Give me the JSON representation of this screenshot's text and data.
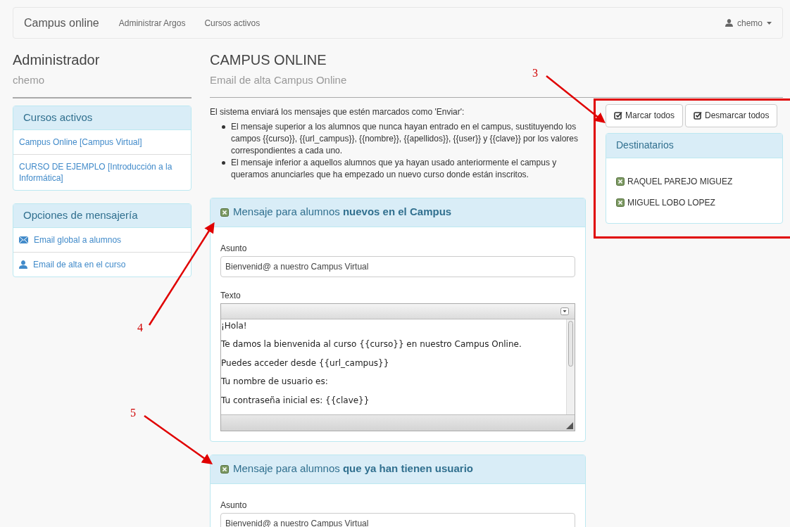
{
  "navbar": {
    "brand": "Campus online",
    "links": [
      "Administrar Argos",
      "Cursos activos"
    ],
    "user": "chemo"
  },
  "sidebar": {
    "title": "Administrador",
    "subtitle": "chemo",
    "panels": [
      {
        "title": "Cursos activos",
        "items": [
          {
            "label": "Campus Online [Campus Virtual]"
          },
          {
            "label": "CURSO DE EJEMPLO [Introducción a la Informática]"
          }
        ]
      },
      {
        "title": "Opciones de mensajería",
        "items": [
          {
            "label": "Email global a alumnos",
            "kind": "envelope"
          },
          {
            "label": "Email de alta en el curso",
            "kind": "user"
          }
        ]
      }
    ]
  },
  "page": {
    "title": "CAMPUS ONLINE",
    "subtitle": "Email de alta Campus Online"
  },
  "intro": {
    "text": "El sistema enviará los mensajes que estén marcados como 'Enviar':",
    "bullets": [
      "El mensaje superior a los alumnos que nunca hayan entrado en el campus, sustituyendo los campos {{curso}}, {{url_campus}}, {{nombre}}, {{apellidos}}, {{user}} y {{clave}} por los valores correspondientes a cada uno.",
      "El mensaje inferior a aquellos alumnos que ya hayan usado anteriormente el campus y queramos anunciarles que ha empezado un nuevo curso donde están inscritos."
    ]
  },
  "messages": [
    {
      "title": "Mensaje para alumnos **nuevos en el Campus**",
      "checked": true,
      "subject_label": "Asunto",
      "subject": "Bienvenid@ a nuestro Campus Virtual",
      "text_label": "Texto",
      "body": [
        "¡Hola!",
        "Te damos la bienvenida al curso {{curso}} en nuestro Campus Online.",
        "Puedes acceder desde {{url_campus}}",
        "Tu nombre de usuario es:",
        "Tu contraseña inicial es: {{clave}}"
      ]
    },
    {
      "title": "Mensaje para alumnos **que ya han tienen usuario**",
      "checked": true,
      "subject_label": "Asunto",
      "subject": "Bienvenid@ a nuestro Campus Virtual"
    }
  ],
  "recipients": {
    "buttons": [
      "Marcar todos",
      "Desmarcar todos"
    ],
    "title": "Destinatarios",
    "items": [
      {
        "name": "RAQUEL PAREJO MIGUEZ",
        "checked": true
      },
      {
        "name": "MIGUEL LOBO LOPEZ",
        "checked": true
      }
    ]
  },
  "annotations": [
    "3",
    "4",
    "5"
  ]
}
